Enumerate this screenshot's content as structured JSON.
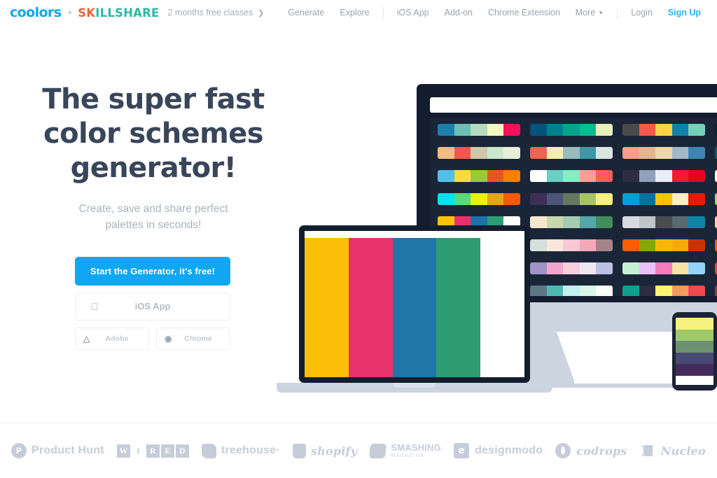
{
  "nav": {
    "brand_primary": "coolors",
    "brand_plus": "+",
    "brand_partner_a": "SK",
    "brand_partner_b": "ILLSHARE",
    "promo_text": "2 months free classes",
    "promo_arrow": "❯",
    "links_left": [
      {
        "label": "Generate",
        "name": "nav-link-generate"
      },
      {
        "label": "Explore",
        "name": "nav-link-explore"
      }
    ],
    "links_mid": [
      {
        "label": "iOS App",
        "name": "nav-link-ios-app"
      },
      {
        "label": "Add-on",
        "name": "nav-link-add-on"
      },
      {
        "label": "Chrome Extension",
        "name": "nav-link-chrome-extension"
      }
    ],
    "more_label": "More",
    "more_caret": "▼",
    "login_label": "Login",
    "signup_label": "Sign Up",
    "accent_color": "#0fa6f2",
    "muted_color": "#9aa3ab"
  },
  "hero": {
    "heading_line1": "The super fast",
    "heading_line2": "color schemes",
    "heading_line3": "generator!",
    "sub_line1": "Create, save and share perfect",
    "sub_line2": "palettes in seconds!",
    "primary_button": "Start the Generator, it's free!",
    "ios_button": "iOS App",
    "ios_icon": "apple-icon",
    "adobe_button": "Adobe",
    "adobe_icon_glyph": "A",
    "chrome_button": "Chrome",
    "chrome_icon": "chrome-icon",
    "heading_color": "#39465a",
    "sub_color": "#aab2bb"
  },
  "illustration": {
    "monitor": {
      "name": "desktop-monitor",
      "bezel_color": "#141d2e",
      "screen_color": "#1a2538",
      "titlebar_color": "#ffffff",
      "stand_color": "#ccd4e0",
      "palette_columns": [
        [
          [
            "#1d7fab",
            "#6cbfb5",
            "#b6dcc0",
            "#f2f7c0",
            "#f70f5a"
          ],
          [
            "#f2bc82",
            "#f4574a",
            "#cfc7a8",
            "#c9e8ce",
            "#e9eedb"
          ],
          [
            "#54bdf0",
            "#fada3c",
            "#9ac93a",
            "#e8561f",
            "#f97f00"
          ],
          [
            "#06e0f0",
            "#5ad97a",
            "#e9f207",
            "#e0a814",
            "#f45a0a"
          ],
          [
            "#fcc409",
            "#e8316c",
            "#1c72a8",
            "#2c9c73",
            "#ffffff"
          ]
        ],
        [
          [
            "#00557d",
            "#00808c",
            "#03a58b",
            "#08bd90",
            "#e7efba"
          ],
          [
            "#ef6350",
            "#f6edb0",
            "#97bcbe",
            "#3e97a7",
            "#dde5e0"
          ],
          [
            "#ffffff",
            "#69cfc4",
            "#83efc4",
            "#fb9e97",
            "#fc5d59"
          ],
          [
            "#3d2f55",
            "#4c5579",
            "#66795f",
            "#a8c364",
            "#f5f081"
          ],
          [
            "#f4e8cd",
            "#c8d6ae",
            "#a5cbb2",
            "#56a5a9",
            "#418d5c"
          ],
          [
            "#d4e0db",
            "#fae7dc",
            "#fbc6d5",
            "#f5a8b8",
            "#a6838b"
          ],
          [
            "#a193c7",
            "#f0a6ce",
            "#f6cede",
            "#efe8f0",
            "#bac2e4"
          ],
          [
            "#5e7683",
            "#4cbab0",
            "#c1f0ee",
            "#d8f5e5",
            "#f8fcf8"
          ]
        ],
        [
          [
            "#494b4a",
            "#f4594c",
            "#fad348",
            "#1380ab",
            "#74d0b6"
          ],
          [
            "#fa9d8b",
            "#e6b590",
            "#edd6ad",
            "#a2b8c6",
            "#3d86b3"
          ],
          [
            "#2e2c45",
            "#93a0b8",
            "#e9eef5",
            "#f01a37",
            "#e30521"
          ],
          [
            "#00a0d2",
            "#0b6f9c",
            "#f3c508",
            "#faeec6",
            "#e71a06"
          ],
          [
            "#d7d9dc",
            "#c2c5c8",
            "#4a4c4e",
            "#5b6973",
            "#0d84a8"
          ],
          [
            "#f85d03",
            "#84a80a",
            "#f9b808",
            "#f4a809",
            "#c93206"
          ],
          [
            "#c6f0d4",
            "#e9c0f7",
            "#f67cbf",
            "#f4e3a2",
            "#94d3f7"
          ],
          [
            "#0e9f8f",
            "#2e2b42",
            "#fcf56f",
            "#f59a61",
            "#f0484f"
          ]
        ],
        [
          [
            "#0d2233"
          ],
          [
            "#0e5b70"
          ],
          [
            "#ffffff"
          ],
          [
            "#a4da63"
          ],
          [
            "#fcd1b0"
          ],
          [
            "#f85d03"
          ],
          [
            "#ef3c4d"
          ],
          [
            "#8b3c4e"
          ]
        ]
      ]
    },
    "laptop": {
      "name": "laptop",
      "bezel_color": "#141d2e",
      "base_color": "#ccd4e0",
      "palette": [
        "#fcbf09",
        "#e6336b",
        "#1f77a8",
        "#2f9b70",
        "#ffffff"
      ]
    },
    "phone": {
      "name": "smartphone",
      "body_color": "#1b2335",
      "palette": [
        "#f6f281",
        "#9ec86a",
        "#6d9070",
        "#464a74",
        "#432b5c"
      ]
    }
  },
  "footer": {
    "logos": [
      {
        "name": "product-hunt-logo",
        "text": "Product Hunt",
        "badge": "P"
      },
      {
        "name": "wired-logo",
        "letters": [
          "W",
          "I",
          "R",
          "E",
          "D"
        ]
      },
      {
        "name": "treehouse-logo",
        "text": "treehouse·"
      },
      {
        "name": "shopify-logo",
        "text": "shopify"
      },
      {
        "name": "smashing-magazine-logo",
        "text": "SMASHING",
        "subtext": "MAGAZINE"
      },
      {
        "name": "designmodo-logo",
        "text": "designmodo",
        "badge": "e"
      },
      {
        "name": "codrops-logo",
        "text": "codrops"
      },
      {
        "name": "nucleo-logo",
        "text": "Nucleo"
      }
    ],
    "logo_color": "#c6ccd8"
  }
}
